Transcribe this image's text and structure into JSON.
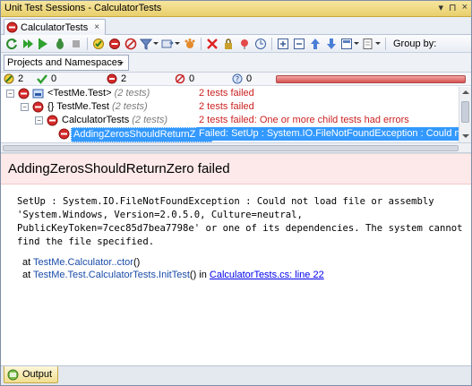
{
  "window": {
    "title": "Unit Test Sessions - CalculatorTests",
    "controls": [
      "▾",
      "⊓",
      "×"
    ]
  },
  "tab": {
    "label": "CalculatorTests",
    "close": "×"
  },
  "toolbar": {
    "group_by_label": "Group by:"
  },
  "grouping": {
    "selected": "Projects and Namespaces"
  },
  "stats": {
    "total": "2",
    "passed": "0",
    "failed": "2",
    "ignored": "0",
    "unknown": "0",
    "progress_failed_fraction": 1.0
  },
  "tree": [
    {
      "name": "<TestMe.Test>",
      "count": "(2 tests)",
      "status": "2 tests failed"
    },
    {
      "name": "{} TestMe.Test",
      "count": "(2 tests)",
      "status": "2 tests failed"
    },
    {
      "name": "CalculatorTests",
      "count": "(2 tests)",
      "status": "2 tests failed: One or more child tests had errors"
    },
    {
      "name": "AddingZerosShouldReturnZero",
      "count": "",
      "status": "Failed: SetUp : System.IO.FileNotFoundException : Could not load"
    }
  ],
  "details": {
    "title": "AddingZerosShouldReturnZero failed",
    "message": "SetUp : System.IO.FileNotFoundException : Could not load file or assembly\n'System.Windows, Version=2.0.5.0, Culture=neutral,\nPublicKeyToken=7cec85d7bea7798e' or one of its dependencies. The system cannot\nfind the file specified.",
    "stack": [
      {
        "at": "at",
        "type": "TestMe.Calculator.",
        "method": ".ctor",
        "suffix": "()",
        "in": "",
        "link": ""
      },
      {
        "at": "at",
        "type": "TestMe.Test.CalculatorTests.",
        "method": "InitTest",
        "suffix": "()",
        "in": " in ",
        "link": "CalculatorTests.cs: line 22"
      }
    ]
  },
  "bottom": {
    "output_label": "Output"
  },
  "colors": {
    "failed": "#cc2222",
    "selection": "#3399ff",
    "progress": "#d85252",
    "title_bar": "#e9cf6b"
  }
}
